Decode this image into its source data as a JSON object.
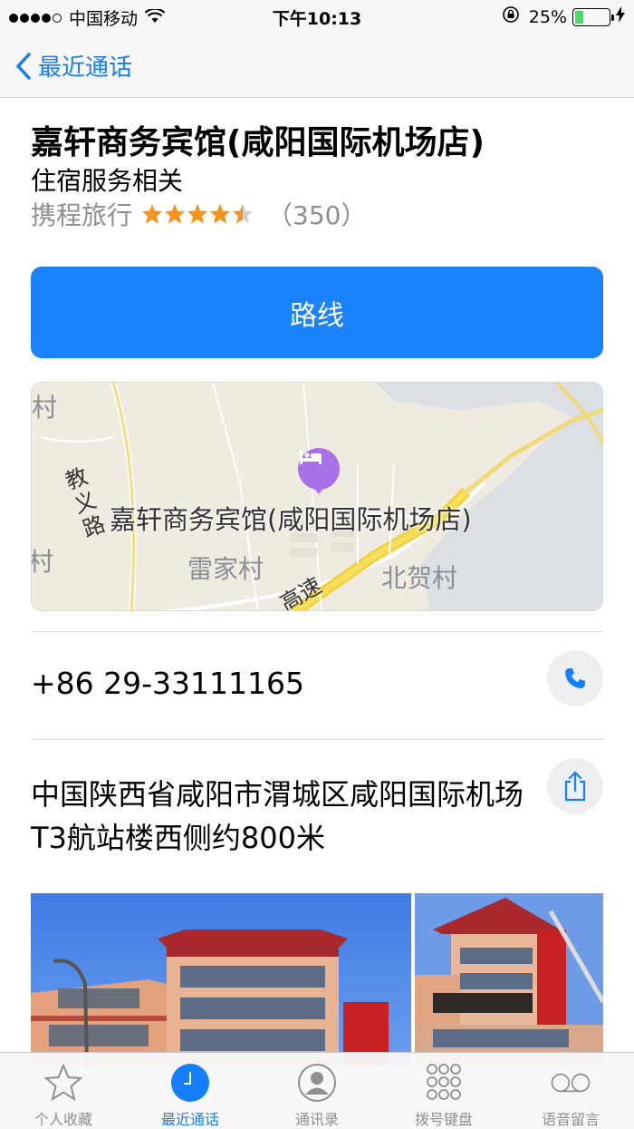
{
  "status_bar": {
    "carrier": "中国移动",
    "time": "下午10:13",
    "battery_percent": "25%",
    "battery_level": 0.25,
    "icons": [
      "signal-icon",
      "wifi-icon",
      "orientation-lock-icon",
      "battery-icon",
      "charging-icon"
    ]
  },
  "nav": {
    "back_label": "最近通话"
  },
  "place": {
    "name": "嘉轩商务宾馆(咸阳国际机场店)",
    "category": "住宿服务相关",
    "source": "携程旅行",
    "rating": 4.5,
    "review_count": "（350）"
  },
  "route_button": "路线",
  "map": {
    "hotel_label": "嘉轩商务宾馆(咸阳国际机场店)",
    "village_1": "雷家村",
    "village_2": "北贺村",
    "road_1": "教义路",
    "road_2": "高速",
    "edge_label_1": "村",
    "edge_label_2": "村"
  },
  "phone": "+86 29-33111165",
  "address": "中国陕西省咸阳市渭城区咸阳国际机场T3航站楼西侧约800米",
  "tabs": [
    {
      "label": "个人收藏",
      "icon": "star-icon"
    },
    {
      "label": "最近通话",
      "icon": "clock-icon"
    },
    {
      "label": "通讯录",
      "icon": "contact-icon"
    },
    {
      "label": "拨号键盘",
      "icon": "keypad-icon"
    },
    {
      "label": "语音留言",
      "icon": "voicemail-icon"
    }
  ],
  "colors": {
    "accent": "#157efb",
    "route_button": "#1a82fb",
    "star": "#f5931f",
    "pin": "#a971e8"
  }
}
